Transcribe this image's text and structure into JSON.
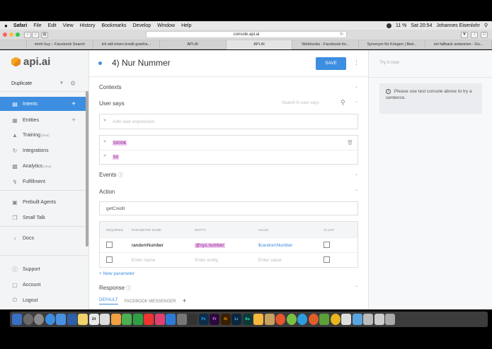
{
  "menubar": {
    "apple": "",
    "items": [
      "Safari",
      "File",
      "Edit",
      "View",
      "History",
      "Bookmarks",
      "Develop",
      "Window",
      "Help"
    ],
    "battery": "11 %",
    "time": "Sat 20:54",
    "user": "Johannes Eisenlohr"
  },
  "browser": {
    "url": "console.api.ai",
    "tabs": [
      "minh huy – Facebook Search",
      "ich will einen kredit gutefra...",
      "API.AI",
      "API.AI",
      "Webhooks - Facebook for...",
      "Synonym für Kriegen | Bed...",
      "siri fallback antworten - Go..."
    ]
  },
  "sidebar": {
    "logo_text": "api.ai",
    "agent_name": "Duplicate",
    "items": [
      {
        "label": "Intents",
        "icon": "chat-icon"
      },
      {
        "label": "Entities",
        "icon": "sitemap-icon"
      },
      {
        "label": "Training",
        "sup": "(beta)",
        "icon": "graduation-icon"
      },
      {
        "label": "Integrations",
        "icon": "sync-icon"
      },
      {
        "label": "Analytics",
        "sup": "(new)",
        "icon": "chart-icon"
      },
      {
        "label": "Fulfillment",
        "icon": "bolt-icon"
      },
      {
        "label": "Prebuilt Agents",
        "icon": "package-icon"
      },
      {
        "label": "Small Talk",
        "icon": "bubbles-icon"
      },
      {
        "label": "Docs",
        "icon": "chevron-right-icon"
      },
      {
        "label": "Support",
        "icon": "question-icon"
      },
      {
        "label": "Account",
        "icon": "account-icon"
      },
      {
        "label": "Logout",
        "icon": "power-icon"
      }
    ]
  },
  "main": {
    "intent_title": "4) Nur Nummer",
    "save_label": "SAVE",
    "contexts_label": "Contexts",
    "user_says_label": "User says",
    "search_placeholder": "Search in user says",
    "add_expression_placeholder": "Add user expression",
    "expressions": [
      "5000€",
      "50"
    ],
    "events_label": "Events",
    "action_label": "Action",
    "action_value": "getCredit",
    "param_headers": [
      "REQUIRED",
      "PARAMETER NAME",
      "ENTITY",
      "VALUE",
      "IS LIST"
    ],
    "params": [
      {
        "name": "randomNumber",
        "entity": "@sys.number",
        "value": "$randomNumber"
      }
    ],
    "empty_row": {
      "name_placeholder": "Enter name",
      "entity_placeholder": "Enter entity",
      "value_placeholder": "Enter value"
    },
    "new_parameter_label": "New parameter",
    "response_label": "Response",
    "response_tabs": [
      "DEFAULT",
      "FACEBOOK MESSENGER"
    ]
  },
  "console": {
    "try_it_now": "Try it now",
    "info_text": "Please use test console above to try a sentence."
  },
  "colors": {
    "accent": "#3d8ee0",
    "highlight": "#f1c6f0"
  }
}
